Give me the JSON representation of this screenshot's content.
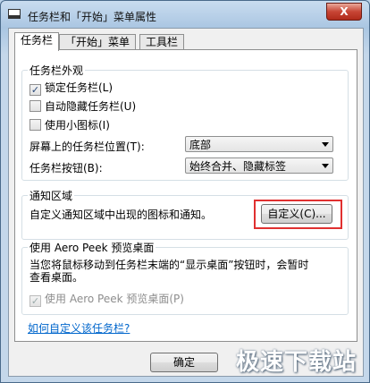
{
  "window": {
    "title": "任务栏和「开始」菜单属性",
    "close_label": "X"
  },
  "tabs": [
    {
      "label": "任务栏"
    },
    {
      "label": "「开始」菜单"
    },
    {
      "label": "工具栏"
    }
  ],
  "appearance": {
    "legend": "任务栏外观",
    "lock": {
      "label": "锁定任务栏(L)",
      "checked": true
    },
    "autohide": {
      "label": "自动隐藏任务栏(U)",
      "checked": false
    },
    "small_icons": {
      "label": "使用小图标(I)",
      "checked": false
    },
    "position_label": "屏幕上的任务栏位置(T):",
    "position_value": "底部",
    "buttons_label": "任务栏按钮(B):",
    "buttons_value": "始终合并、隐藏标签"
  },
  "notification": {
    "legend": "通知区域",
    "description": "自定义通知区域中出现的图标和通知。",
    "customize_label": "自定义(C)..."
  },
  "aero_peek": {
    "legend": "使用 Aero Peek 预览桌面",
    "description_line1": "当您将鼠标移动到任务栏末端的“显示桌面”按钮时，会暂时",
    "description_line2": "查看桌面。",
    "checkbox_label": "使用 Aero Peek 预览桌面(P)",
    "checked": true
  },
  "help_link": "如何自定义该任务栏?",
  "footer": {
    "ok_label": "确定"
  },
  "watermark": "极速下载站",
  "colors": {
    "highlight": "#e03030",
    "link": "#0066cc"
  }
}
